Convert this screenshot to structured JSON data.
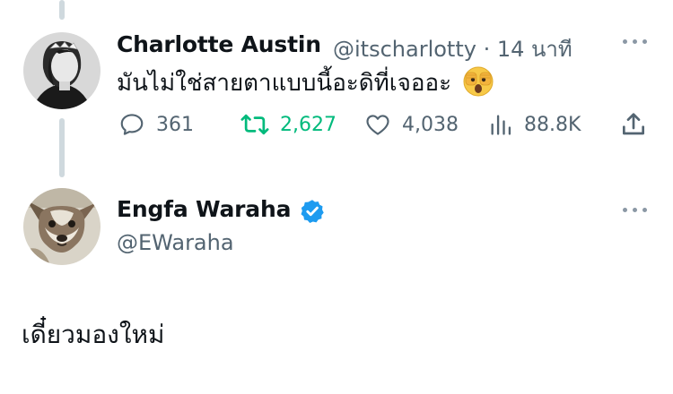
{
  "tweet1": {
    "author_name": "Charlotte Austin",
    "handle": "@itscharlotty",
    "separator": "·",
    "time": "14 นาที",
    "text": "มันไม่ใช่สายตาแบบนี้อะดิที่เจออะ",
    "emoji": "peeking-face",
    "actions": {
      "replies": "361",
      "retweets": "2,627",
      "likes": "4,038",
      "views": "88.8K"
    }
  },
  "tweet2": {
    "author_name": "Engfa Waraha",
    "handle": "@EWaraha",
    "verified": true,
    "text": "เดี๋ยวมองใหม่"
  },
  "colors": {
    "text_primary": "#0f1419",
    "text_secondary": "#536471",
    "retweet_green": "#00ba7c",
    "verified_blue": "#1d9bf0",
    "thread_line": "#cfd9de"
  },
  "icons": [
    "reply-icon",
    "retweet-icon",
    "like-icon",
    "views-icon",
    "share-icon",
    "more-icon",
    "verified-badge-icon"
  ]
}
